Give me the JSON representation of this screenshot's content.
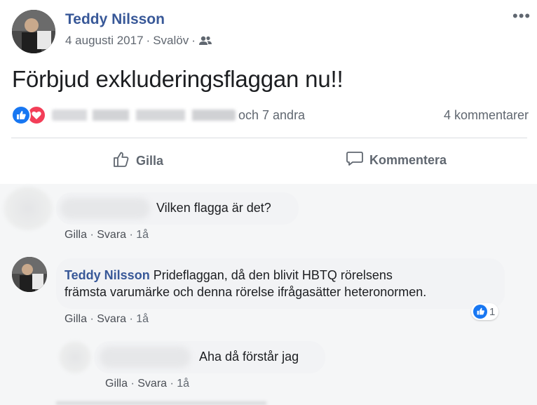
{
  "post": {
    "author": "Teddy Nilsson",
    "date": "4 augusti 2017",
    "separator": "·",
    "location": "Svalöv",
    "audience_icon": "friends-icon",
    "more_label": "•••",
    "text": "Förbjud exkluderingsflaggan nu!!",
    "reactions": {
      "types": [
        "like",
        "love"
      ],
      "others_text": "och 7 andra",
      "comments_count_text": "4 kommentarer"
    },
    "actions": {
      "like_label": "Gilla",
      "comment_label": "Kommentera"
    }
  },
  "comments": [
    {
      "author": "",
      "text": "Vilken flagga är det?",
      "actions": {
        "like": "Gilla",
        "reply": "Svara",
        "time": "1å"
      }
    },
    {
      "author": "Teddy Nilsson",
      "text_line1": "Prideflaggan, då den blivit HBTQ rörelsens",
      "text_line2": "främsta varumärke och denna rörelse ifrågasätter heteronormen.",
      "reaction_count": "1",
      "actions": {
        "like": "Gilla",
        "reply": "Svara",
        "time": "1å"
      }
    },
    {
      "author": "",
      "text": "Aha då förstår jag",
      "actions": {
        "like": "Gilla",
        "reply": "Svara",
        "time": "1å"
      }
    }
  ],
  "colors": {
    "name_link": "#385898",
    "meta_gray": "#606770",
    "like_blue": "#1877f2",
    "love_red": "#f33e58",
    "bubble_bg": "#f2f3f5",
    "comments_bg": "#f5f6f7"
  }
}
